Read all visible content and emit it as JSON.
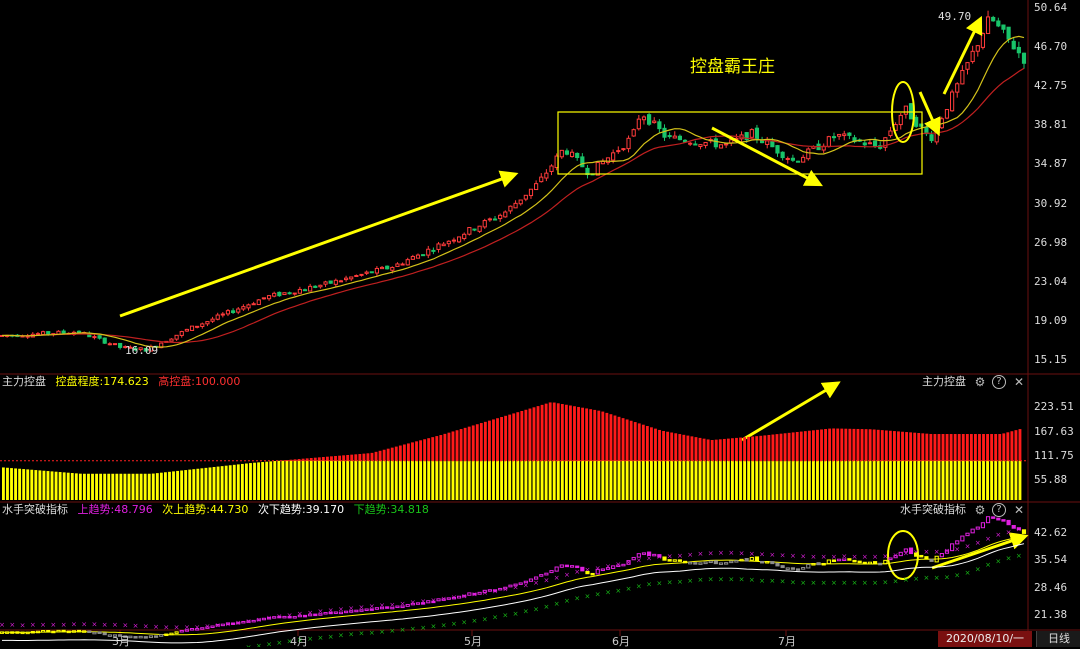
{
  "colors": {
    "up": "#ff3b3b",
    "down": "#19c46a",
    "ma1": "#d4c21a",
    "ma2": "#c02020",
    "yellow": "#ffff00",
    "magenta": "#e020e0",
    "green": "#19c419",
    "gray": "#8c8c8c"
  },
  "main": {
    "annotation_title": "控盘霸王庄",
    "high_label": "49.70",
    "low_label": "16.09",
    "price_axis": [
      "50.64",
      "46.70",
      "42.75",
      "38.81",
      "34.87",
      "30.92",
      "26.98",
      "23.04",
      "19.09",
      "15.15"
    ]
  },
  "panel1": {
    "name": "主力控盘",
    "metric_label": "控盘程度",
    "metric_value": "174.623",
    "high_label": "高控盘",
    "high_value": "100.000",
    "title_right": "主力控盘",
    "axis": [
      "223.51",
      "167.63",
      "111.75",
      "55.88"
    ]
  },
  "panel2": {
    "name": "水手突破指标",
    "title_right": "水手突破指标",
    "up_label": "上趋势",
    "up_value": "48.796",
    "subup_label": "次上趋势",
    "subup_value": "44.730",
    "subdown_label": "次下趋势",
    "subdown_value": "39.170",
    "down_label": "下趋势",
    "down_value": "34.818",
    "axis": [
      "42.62",
      "35.54",
      "28.46",
      "21.38"
    ]
  },
  "x_axis": {
    "months": [
      "3月",
      "4月",
      "5月",
      "6月",
      "7月"
    ],
    "date_cursor": "2020/08/10/一",
    "period_button": "日线"
  },
  "icons": {
    "settings": "gear-icon",
    "help": "question-icon",
    "close": "close-icon"
  }
}
